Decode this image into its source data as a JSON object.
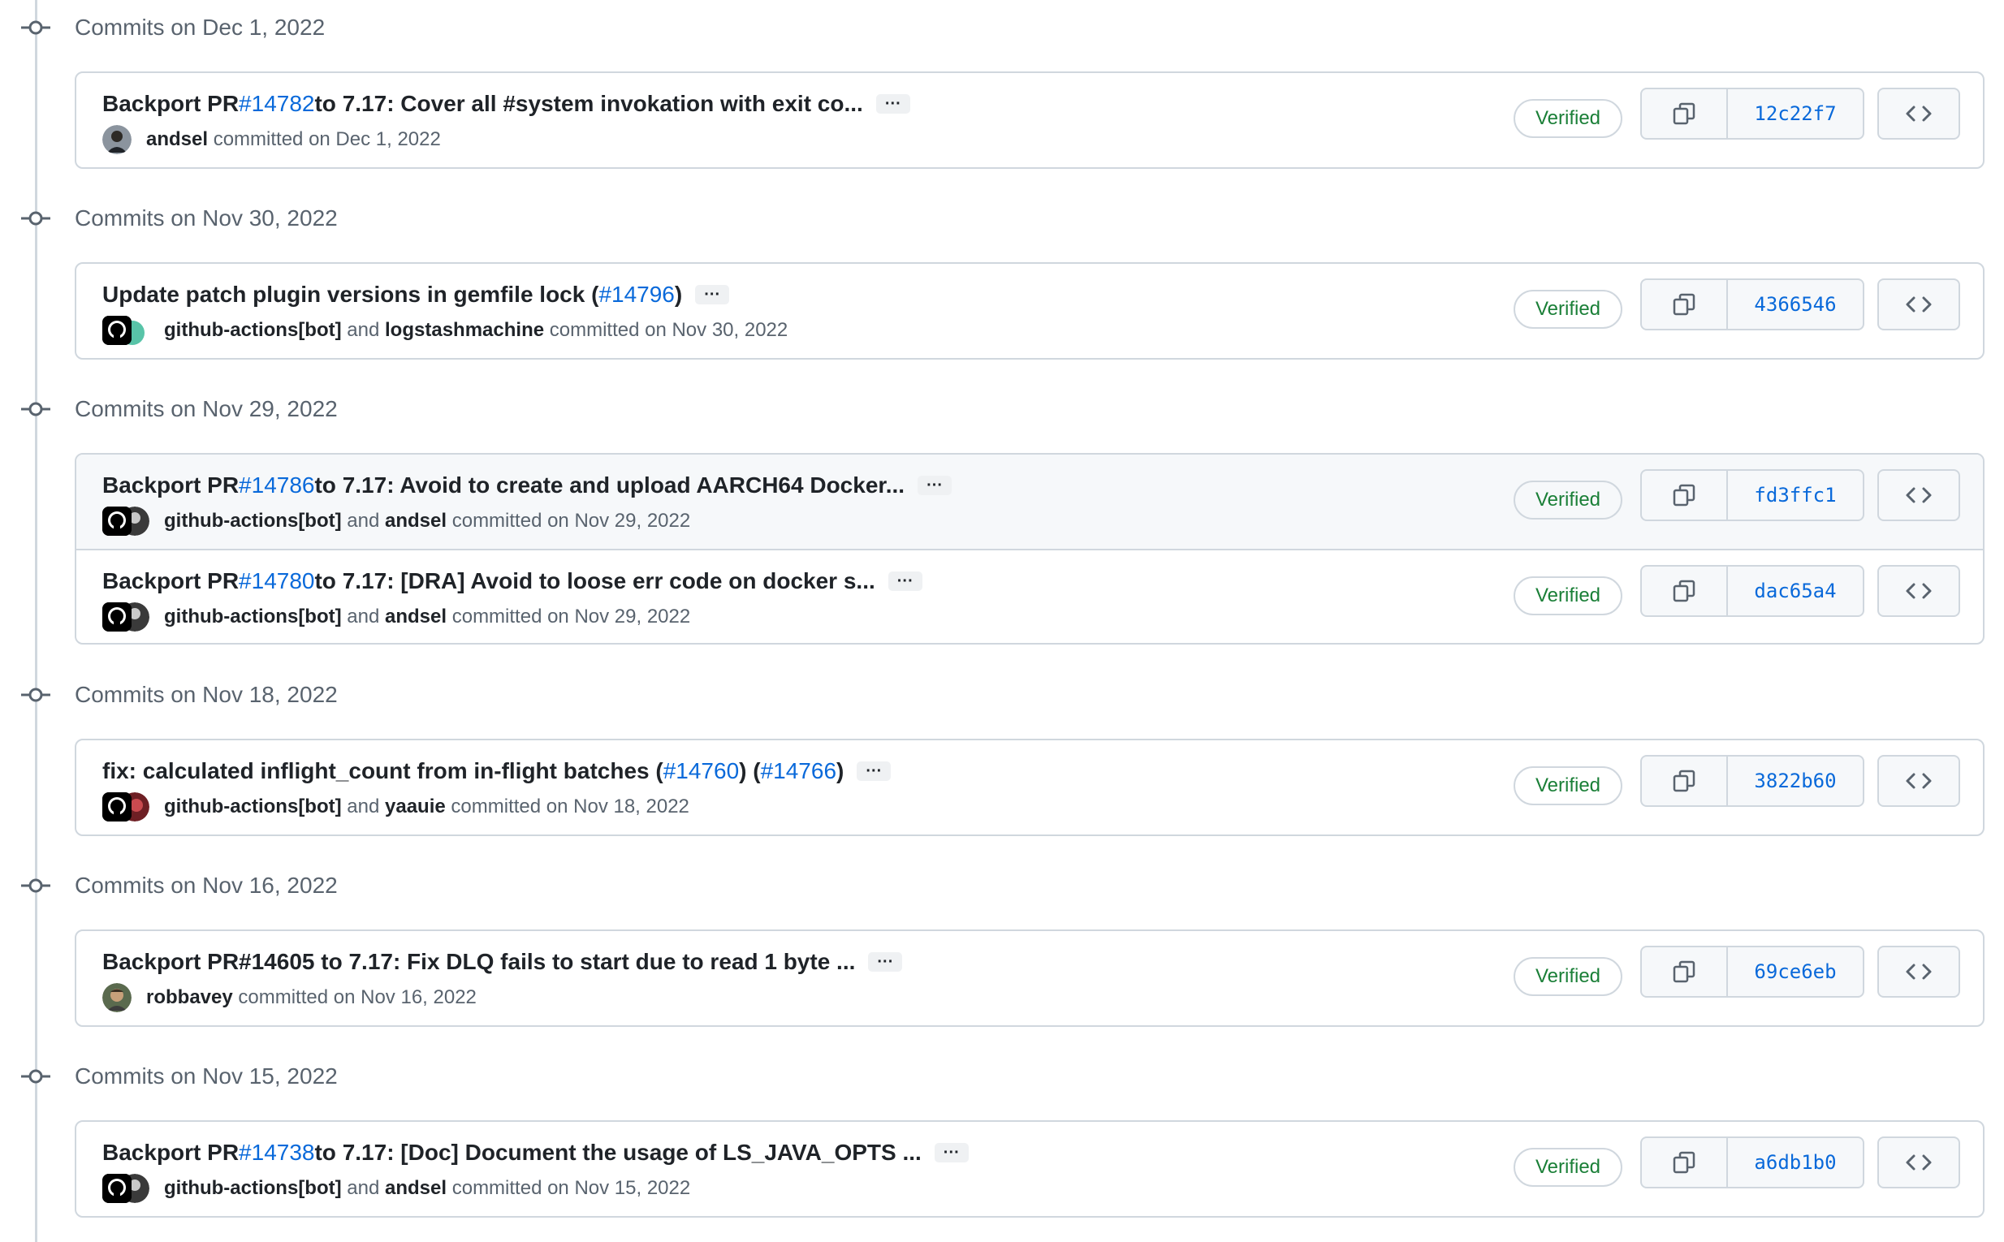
{
  "groups": [
    {
      "title": "Commits on Dec 1, 2022",
      "commits": [
        {
          "msg_pre": "Backport PR ",
          "link": "#14782",
          "msg_post": " to 7.17: Cover all #system invokation with exit co...",
          "author1": "andsel",
          "joiner": "",
          "author2": "",
          "committed": "committed on Dec 1, 2022",
          "verified": "Verified",
          "sha": "12c22f7",
          "avatar_type": "user"
        }
      ]
    },
    {
      "title": "Commits on Nov 30, 2022",
      "commits": [
        {
          "msg_pre": "Update patch plugin versions in gemfile lock (",
          "link": "#14796",
          "msg_post": ")",
          "author1": "github-actions[bot]",
          "joiner": "and",
          "author2": "logstashmachine",
          "committed": "committed on Nov 30, 2022",
          "verified": "Verified",
          "sha": "4366546",
          "avatar_type": "gh"
        }
      ]
    },
    {
      "title": "Commits on Nov 29, 2022",
      "commits": [
        {
          "msg_pre": "Backport PR ",
          "link": "#14786",
          "msg_post": " to 7.17: Avoid to create and upload AARCH64 Docker...",
          "author1": "github-actions[bot]",
          "joiner": "and",
          "author2": "andsel",
          "committed": "committed on Nov 29, 2022",
          "verified": "Verified",
          "sha": "fd3ffc1",
          "avatar_type": "gh"
        },
        {
          "msg_pre": "Backport PR ",
          "link": "#14780",
          "msg_post": " to 7.17: [DRA] Avoid to loose err code on docker s...",
          "author1": "github-actions[bot]",
          "joiner": "and",
          "author2": "andsel",
          "committed": "committed on Nov 29, 2022",
          "verified": "Verified",
          "sha": "dac65a4",
          "avatar_type": "gh"
        }
      ]
    },
    {
      "title": "Commits on Nov 18, 2022",
      "commits": [
        {
          "msg_pre": "fix: calculated inflight_count from in-flight batches (",
          "link": "#14760",
          "msg_mid": ") (",
          "link2": "#14766",
          "msg_post": ")",
          "author1": "github-actions[bot]",
          "joiner": "and",
          "author2": "yaauie",
          "committed": "committed on Nov 18, 2022",
          "verified": "Verified",
          "sha": "3822b60",
          "avatar_type": "gh"
        }
      ]
    },
    {
      "title": "Commits on Nov 16, 2022",
      "commits": [
        {
          "msg_pre": "Backport PR#14605 to 7.17: Fix DLQ fails to start due to read 1 byte ...",
          "link": "",
          "msg_post": "",
          "author1": "robbavey",
          "joiner": "",
          "author2": "",
          "committed": "committed on Nov 16, 2022",
          "verified": "Verified",
          "sha": "69ce6eb",
          "avatar_type": "user"
        }
      ]
    },
    {
      "title": "Commits on Nov 15, 2022",
      "commits": [
        {
          "msg_pre": "Backport PR ",
          "link": "#14738",
          "msg_post": " to 7.17: [Doc] Document the usage of LS_JAVA_OPTS ...",
          "author1": "github-actions[bot]",
          "joiner": "and",
          "author2": "andsel",
          "committed": "committed on Nov 15, 2022",
          "verified": "Verified",
          "sha": "a6db1b0",
          "avatar_type": "gh"
        }
      ]
    }
  ],
  "ellipsis": "···",
  "colors": {
    "link": "#0969da",
    "verified": "#1a7f37",
    "border": "#d0d7de",
    "muted": "#59636e"
  }
}
